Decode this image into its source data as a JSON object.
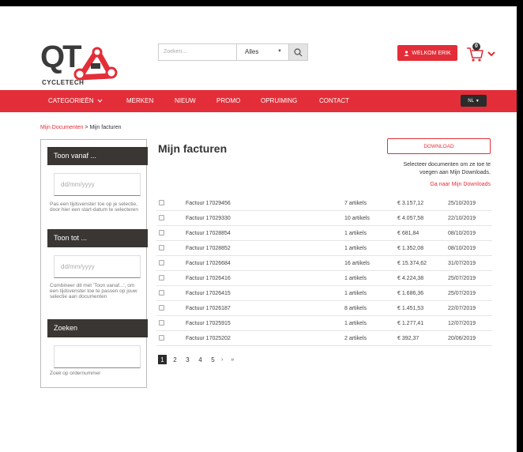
{
  "header": {
    "logo_text": "QT",
    "logo_sub": "CYCLETECH",
    "search_placeholder": "Zoeken...",
    "search_scope": "Alles",
    "welcome_label": "WELKOM ERIK",
    "cart_count": "0"
  },
  "nav": {
    "items": [
      "CATEGORIEËN",
      "MERKEN",
      "NIEUW",
      "PROMO",
      "OPRUIMING",
      "CONTACT"
    ],
    "language": "NL"
  },
  "breadcrumb": {
    "parent": "Mijn Documenten",
    "separator": ">",
    "current": "Mijn facturen"
  },
  "sidebar": {
    "from_title": "Toon vanaf ...",
    "from_placeholder": "dd/mm/yyyy",
    "from_help": "Pas een tijdsvenster toe op je selectie, door hier een start-datum te selecteren",
    "to_title": "Toon tot ...",
    "to_placeholder": "dd/mm/yyyy",
    "to_help": "Combineer dit met 'Toon vanaf...', om een tijdsvenster toe te passen op jouw selectie aan documenten",
    "search_title": "Zoeken",
    "search_help": "Zoek op ordernummer"
  },
  "main": {
    "title": "Mijn facturen",
    "download_label": "DOWNLOAD",
    "hint": "Selecteer documenten om ze toe te voegen aan Mijn Downloads.",
    "goto_link": "Ga naar Mijn Downloads"
  },
  "invoices": [
    {
      "name": "Factuur 17029456",
      "articles": "7 artikels",
      "amount": "€ 3.157,12",
      "date": "25/10/2019"
    },
    {
      "name": "Factuur 17029330",
      "articles": "10 artikels",
      "amount": "€ 4.057,58",
      "date": "22/10/2019"
    },
    {
      "name": "Factuur 17028854",
      "articles": "1 artikels",
      "amount": "€ 681,84",
      "date": "08/10/2019"
    },
    {
      "name": "Factuur 17028852",
      "articles": "1 artikels",
      "amount": "€ 1.352,08",
      "date": "08/10/2019"
    },
    {
      "name": "Factuur 17026684",
      "articles": "16 artikels",
      "amount": "€ 15.374,62",
      "date": "31/07/2019"
    },
    {
      "name": "Factuur 17026416",
      "articles": "1 artikels",
      "amount": "€ 4.224,38",
      "date": "25/07/2019"
    },
    {
      "name": "Factuur 17026415",
      "articles": "1 artikels",
      "amount": "€ 1.686,36",
      "date": "25/07/2019"
    },
    {
      "name": "Factuur 17026187",
      "articles": "8 artikels",
      "amount": "€ 1.451,53",
      "date": "22/07/2019"
    },
    {
      "name": "Factuur 17025915",
      "articles": "1 artikels",
      "amount": "€ 1.277,41",
      "date": "12/07/2019"
    },
    {
      "name": "Factuur 17025202",
      "articles": "2 artikels",
      "amount": "€ 392,37",
      "date": "20/06/2019"
    }
  ],
  "pagination": {
    "pages": [
      "1",
      "2",
      "3",
      "4",
      "5"
    ],
    "current": "1",
    "next": "›",
    "last": "»"
  },
  "colors": {
    "brand_red": "#e32e39",
    "dark": "#3a3634"
  }
}
